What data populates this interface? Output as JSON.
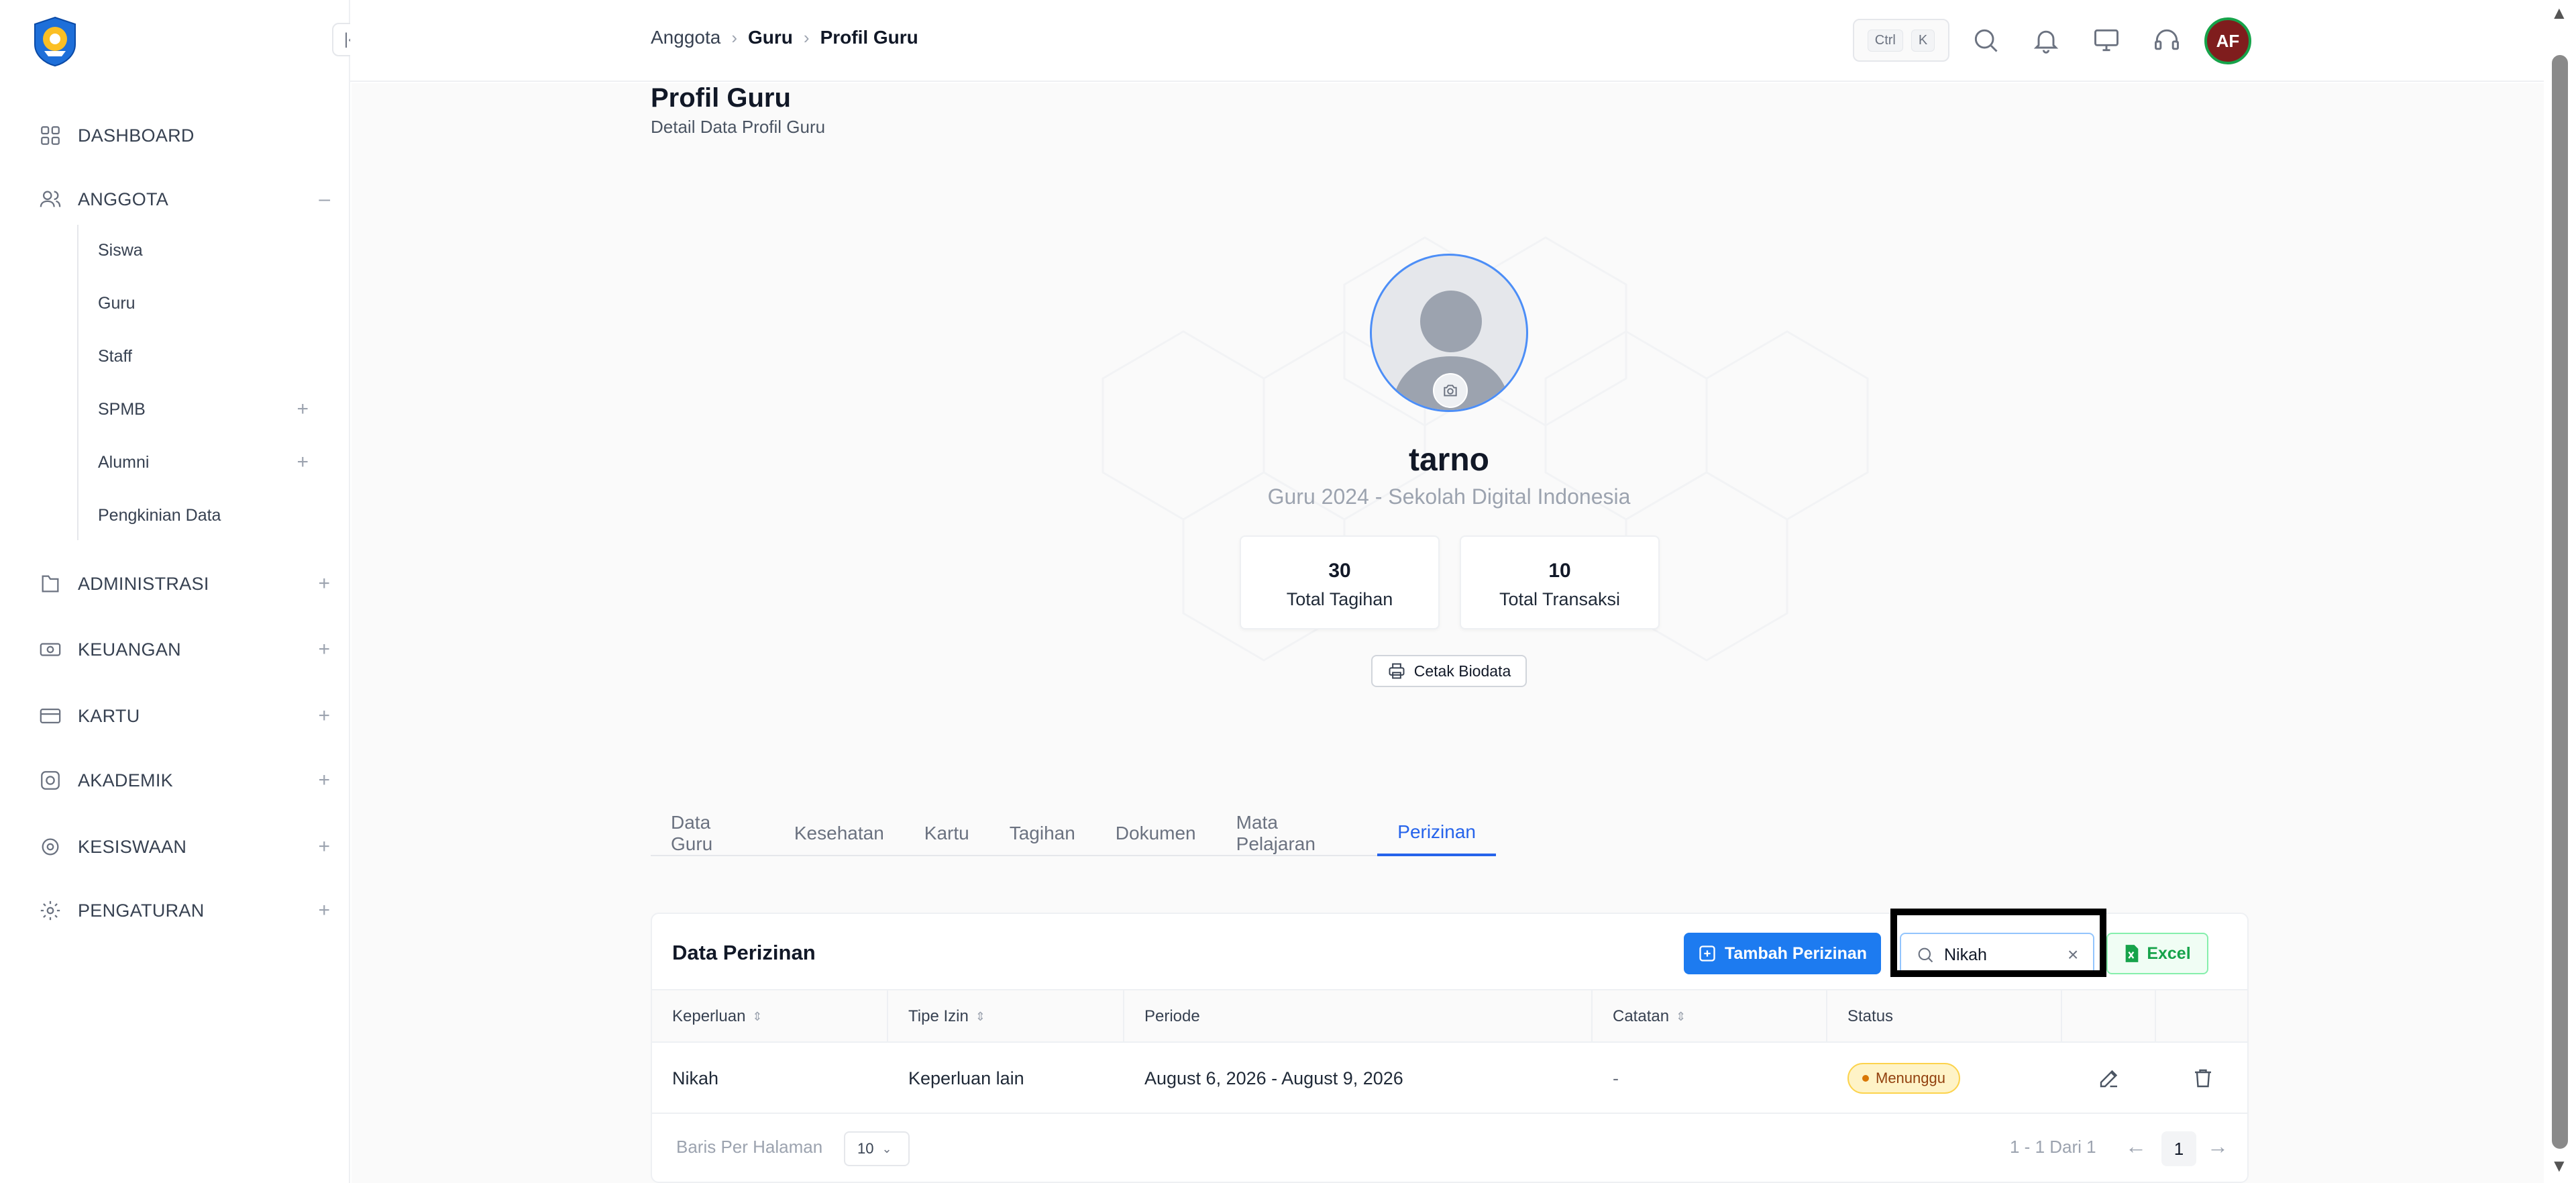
{
  "sidebar": {
    "logo": "tut-wuri-handayani-logo",
    "collapse_icon": "collapse-sidebar-icon",
    "nav": {
      "dashboard": "DASHBOARD",
      "anggota": "ANGGOTA",
      "administrasi": "ADMINISTRASI",
      "keuangan": "KEUANGAN",
      "kartu": "KARTU",
      "akademik": "AKADEMIK",
      "kesiswaan": "KESISWAAN",
      "pengaturan": "PENGATURAN"
    },
    "anggota_sub": {
      "siswa": "Siswa",
      "guru": "Guru",
      "staff": "Staff",
      "spmb": "SPMB",
      "alumni": "Alumni",
      "pengkinian": "Pengkinian Data"
    },
    "toggle_expanded": "–",
    "toggle_collapsed": "+"
  },
  "topbar": {
    "breadcrumb": [
      "Anggota",
      "Guru",
      "Profil Guru"
    ],
    "shortcut": [
      "Ctrl",
      "K"
    ],
    "avatar_initials": "AF"
  },
  "page": {
    "title": "Profil Guru",
    "subtitle": "Detail Data Profil Guru"
  },
  "profile": {
    "name": "tarno",
    "role": "Guru 2024 - Sekolah Digital Indonesia",
    "stats": [
      {
        "value": "30",
        "label": "Total Tagihan"
      },
      {
        "value": "10",
        "label": "Total Transaksi"
      }
    ],
    "print_label": "Cetak Biodata"
  },
  "tabs": [
    "Data Guru",
    "Kesehatan",
    "Kartu",
    "Tagihan",
    "Dokumen",
    "Mata Pelajaran",
    "Perizinan"
  ],
  "active_tab": "Perizinan",
  "perizinan": {
    "title": "Data Perizinan",
    "add_label": "Tambah Perizinan",
    "search_value": "Nikah",
    "excel_label": "Excel",
    "columns": [
      "Keperluan",
      "Tipe Izin",
      "Periode",
      "Catatan",
      "Status"
    ],
    "rows": [
      {
        "keperluan": "Nikah",
        "tipe_izin": "Keperluan lain",
        "periode": "August 6, 2026 - August 9, 2026",
        "catatan": "-",
        "status": "Menunggu"
      }
    ],
    "rows_per_page_label": "Baris Per Halaman",
    "rows_per_page": "10",
    "pager_info": "1 - 1 Dari 1",
    "current_page": "1"
  },
  "colors": {
    "accent": "#1d7bf0",
    "active_tab": "#2563eb",
    "excel": "#16a34a",
    "status_pending_bg": "#fef3c7",
    "avatar_ring": "#16a34a"
  }
}
